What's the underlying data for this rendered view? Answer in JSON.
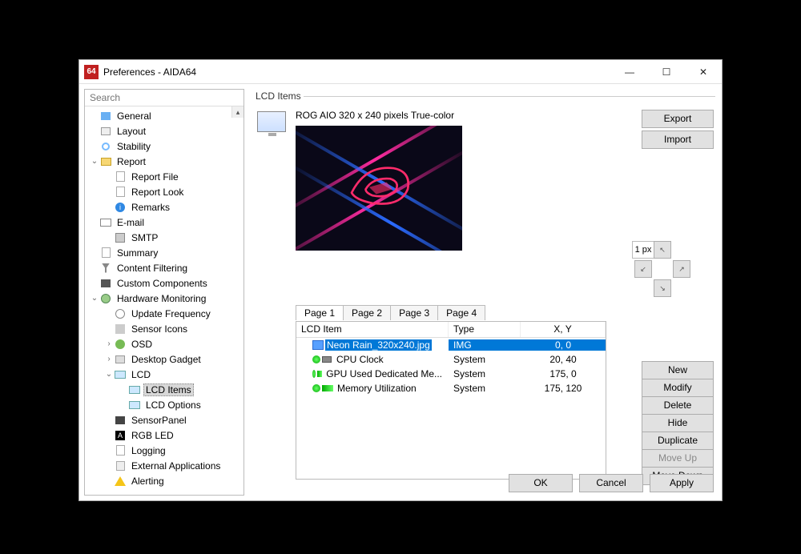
{
  "window": {
    "icon": "64",
    "title": "Preferences - AIDA64"
  },
  "search": {
    "placeholder": "Search"
  },
  "tree": [
    {
      "label": "General",
      "depth": 0,
      "icon": "i-gen"
    },
    {
      "label": "Layout",
      "depth": 0,
      "icon": "i-lay"
    },
    {
      "label": "Stability",
      "depth": 0,
      "icon": "i-stab"
    },
    {
      "label": "Report",
      "depth": 0,
      "icon": "i-fold",
      "exp": "v"
    },
    {
      "label": "Report File",
      "depth": 1,
      "icon": "i-doc"
    },
    {
      "label": "Report Look",
      "depth": 1,
      "icon": "i-doc"
    },
    {
      "label": "Remarks",
      "depth": 1,
      "icon": "i-info",
      "iconText": "i"
    },
    {
      "label": "E-mail",
      "depth": 0,
      "icon": "i-mail"
    },
    {
      "label": "SMTP",
      "depth": 1,
      "icon": "i-drv"
    },
    {
      "label": "Summary",
      "depth": 0,
      "icon": "i-doc"
    },
    {
      "label": "Content Filtering",
      "depth": 0,
      "icon": "i-filt"
    },
    {
      "label": "Custom Components",
      "depth": 0,
      "icon": "i-chip"
    },
    {
      "label": "Hardware Monitoring",
      "depth": 0,
      "icon": "i-mon",
      "exp": "v"
    },
    {
      "label": "Update Frequency",
      "depth": 1,
      "icon": "i-clk"
    },
    {
      "label": "Sensor Icons",
      "depth": 1,
      "icon": "i-sens"
    },
    {
      "label": "OSD",
      "depth": 1,
      "icon": "i-osd",
      "exp": ">"
    },
    {
      "label": "Desktop Gadget",
      "depth": 1,
      "icon": "i-dg",
      "exp": ">"
    },
    {
      "label": "LCD",
      "depth": 1,
      "icon": "i-lcd",
      "exp": "v"
    },
    {
      "label": "LCD Items",
      "depth": 2,
      "icon": "i-lcd",
      "selected": true
    },
    {
      "label": "LCD Options",
      "depth": 2,
      "icon": "i-lcd"
    },
    {
      "label": "SensorPanel",
      "depth": 1,
      "icon": "i-sp"
    },
    {
      "label": "RGB LED",
      "depth": 1,
      "icon": "i-rgb",
      "iconText": "A"
    },
    {
      "label": "Logging",
      "depth": 1,
      "icon": "i-log"
    },
    {
      "label": "External Applications",
      "depth": 1,
      "icon": "i-ext"
    },
    {
      "label": "Alerting",
      "depth": 1,
      "icon": "i-warn"
    }
  ],
  "panel": {
    "group": "LCD Items",
    "display": "ROG AIO 320 x 240 pixels True-color",
    "export": "Export",
    "import": "Import",
    "nudge_step": "1 px",
    "tabs": [
      "Page 1",
      "Page 2",
      "Page 3",
      "Page 4"
    ],
    "active_tab": 0,
    "columns": {
      "item": "LCD Item",
      "type": "Type",
      "xy": "X, Y"
    },
    "rows": [
      {
        "name": "Neon Rain_320x240.jpg",
        "type": "IMG",
        "xy": "0, 0",
        "icon": "img",
        "selected": true
      },
      {
        "name": "CPU Clock",
        "type": "System",
        "xy": "20, 40",
        "icon": "cpu"
      },
      {
        "name": "GPU Used Dedicated Me...",
        "type": "System",
        "xy": "175, 0",
        "icon": "gpu"
      },
      {
        "name": "Memory Utilization",
        "type": "System",
        "xy": "175, 120",
        "icon": "mem"
      }
    ],
    "side_buttons": {
      "new": "New",
      "modify": "Modify",
      "delete": "Delete",
      "hide": "Hide",
      "duplicate": "Duplicate",
      "moveup": "Move Up",
      "movedown": "Move Down"
    }
  },
  "footer": {
    "ok": "OK",
    "cancel": "Cancel",
    "apply": "Apply"
  }
}
